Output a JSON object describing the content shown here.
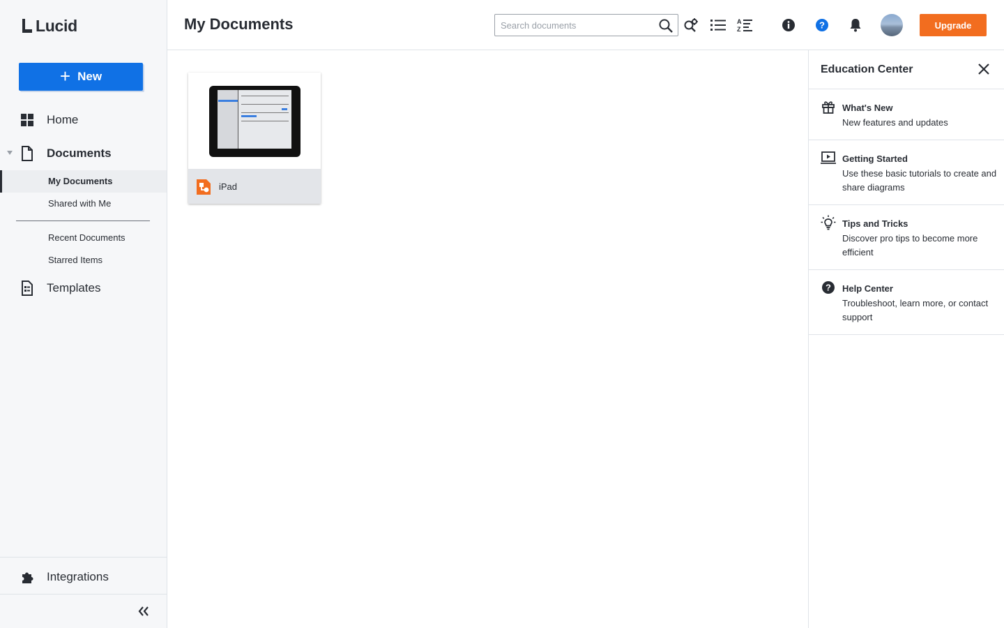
{
  "brand": {
    "name": "Lucid",
    "accent": "#1071e5",
    "upgrade_color": "#f26d1f"
  },
  "sidebar": {
    "new_button": "New",
    "home": "Home",
    "documents": "Documents",
    "sub_items": {
      "my_documents": "My Documents",
      "shared_with_me": "Shared with Me",
      "recent_documents": "Recent Documents",
      "starred_items": "Starred Items"
    },
    "templates": "Templates",
    "integrations": "Integrations"
  },
  "header": {
    "title": "My Documents",
    "search_placeholder": "Search documents",
    "upgrade": "Upgrade",
    "icons": [
      "search-icon",
      "advanced-search-icon",
      "list-view-icon",
      "sort-az-icon",
      "info-icon",
      "help-icon",
      "bell-icon"
    ]
  },
  "documents": [
    {
      "name": "iPad",
      "type_icon": "lucidchart-icon"
    }
  ],
  "education": {
    "title": "Education Center",
    "items": [
      {
        "title": "What's New",
        "desc": "New features and updates",
        "icon": "gift-icon"
      },
      {
        "title": "Getting Started",
        "desc": "Use these basic tutorials to create and share diagrams",
        "icon": "video-tutorial-icon"
      },
      {
        "title": "Tips and Tricks",
        "desc": "Discover pro tips to become more efficient",
        "icon": "lightbulb-icon"
      },
      {
        "title": "Help Center",
        "desc": "Troubleshoot, learn more, or contact support",
        "icon": "question-circle-icon"
      }
    ]
  }
}
